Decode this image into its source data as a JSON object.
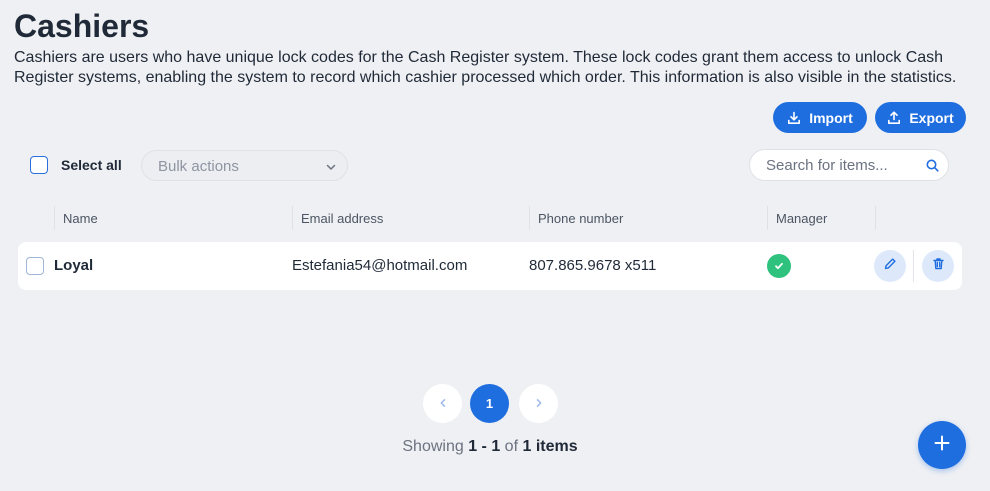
{
  "page": {
    "title": "Cashiers",
    "description": "Cashiers are users who have unique lock codes for the Cash Register system. These lock codes grant them access to unlock Cash Register systems, enabling the system to record which cashier processed which order. This information is also visible in the statistics."
  },
  "toolbar": {
    "import_label": "Import",
    "export_label": "Export",
    "select_all_label": "Select all",
    "bulk_actions_placeholder": "Bulk actions",
    "search_placeholder": "Search for items..."
  },
  "table": {
    "columns": [
      "Name",
      "Email address",
      "Phone number",
      "Manager"
    ],
    "rows": [
      {
        "name": "Loyal",
        "email": "Estefania54@hotmail.com",
        "phone": "807.865.9678 x511",
        "manager": true
      }
    ]
  },
  "pagination": {
    "current_page": "1",
    "showing_prefix": "Showing",
    "range": "1 - 1",
    "of_label": "of",
    "total": "1 items"
  },
  "colors": {
    "accent": "#1f6ee0",
    "manager_check": "#2ec27e",
    "background": "#eff0f3"
  },
  "icons": {
    "import": "download-icon",
    "export": "upload-icon",
    "bulk": "chevron-down-icon",
    "search": "search-icon",
    "edit": "pencil-icon",
    "delete": "trash-icon",
    "prev": "chevron-left-icon",
    "next": "chevron-right-icon",
    "add": "plus-icon"
  }
}
